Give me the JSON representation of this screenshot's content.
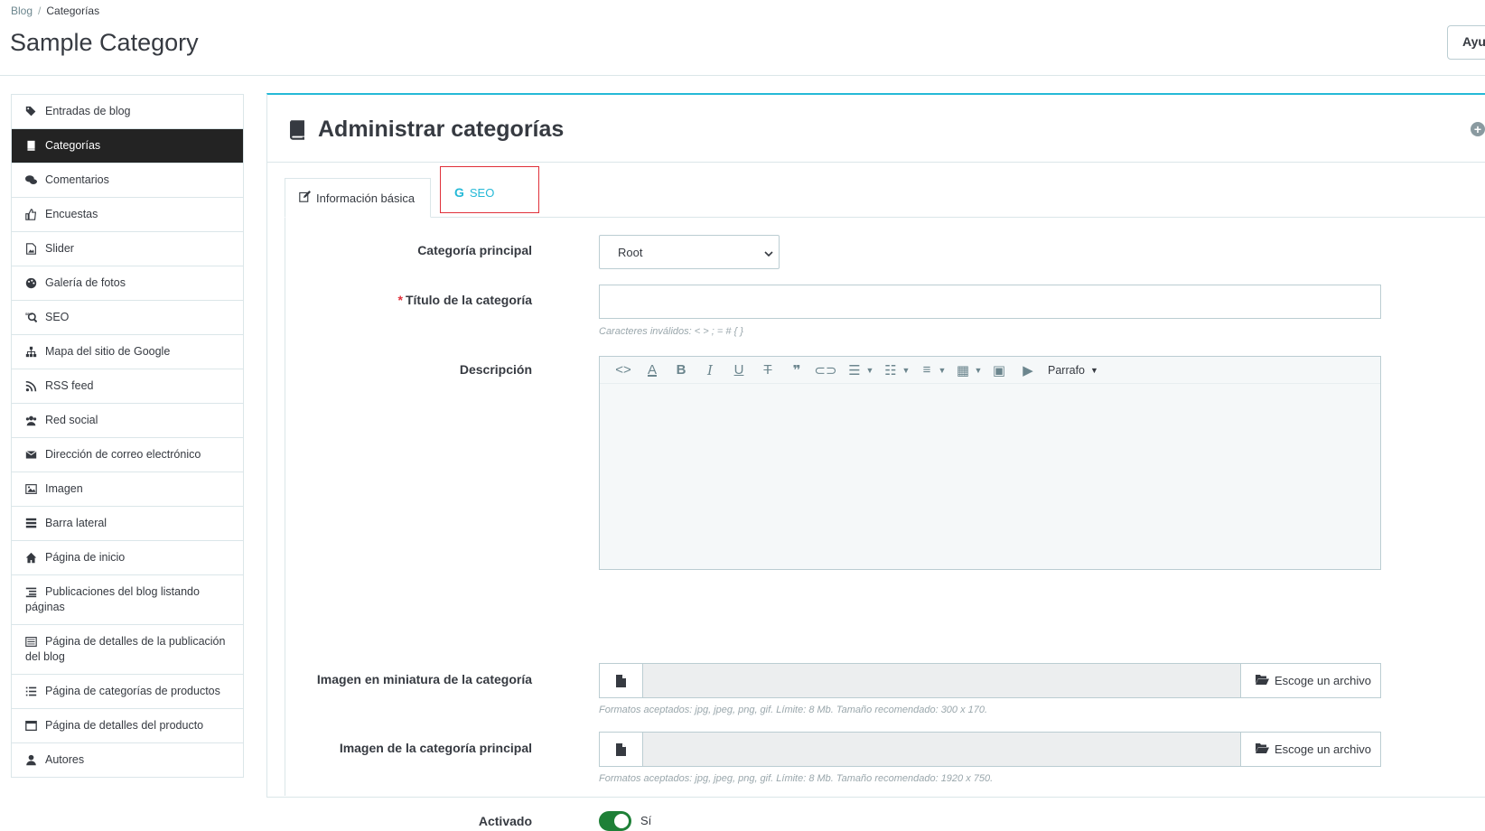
{
  "breadcrumb": {
    "parent": "Blog",
    "separator": "/",
    "current": "Categorías"
  },
  "page": {
    "title": "Sample Category",
    "help_button": "Ayu"
  },
  "sidebar": {
    "items": [
      {
        "label": "Entradas de blog",
        "icon": "tags-icon"
      },
      {
        "label": "Categorías",
        "icon": "book-icon",
        "active": true
      },
      {
        "label": "Comentarios",
        "icon": "comments-icon"
      },
      {
        "label": "Encuestas",
        "icon": "thumbs-up-icon"
      },
      {
        "label": "Slider",
        "icon": "file-image-icon"
      },
      {
        "label": "Galería de fotos",
        "icon": "palette-icon"
      },
      {
        "label": "SEO",
        "icon": "seo-search-icon"
      },
      {
        "label": "Mapa del sitio de Google",
        "icon": "sitemap-icon"
      },
      {
        "label": "RSS feed",
        "icon": "rss-icon"
      },
      {
        "label": "Red social",
        "icon": "users-icon"
      },
      {
        "label": "Dirección de correo electrónico",
        "icon": "envelope-icon"
      },
      {
        "label": "Imagen",
        "icon": "image-icon"
      },
      {
        "label": "Barra lateral",
        "icon": "sidebar-icon"
      },
      {
        "label": "Página de inicio",
        "icon": "home-icon"
      },
      {
        "label": "Publicaciones del blog listando páginas",
        "icon": "list-indent-icon"
      },
      {
        "label": "Página de detalles de la publicación del blog",
        "icon": "list-alt-icon"
      },
      {
        "label": "Página de categorías de productos",
        "icon": "list-icon"
      },
      {
        "label": "Página de detalles del producto",
        "icon": "window-icon"
      },
      {
        "label": "Autores",
        "icon": "user-icon"
      }
    ]
  },
  "panel": {
    "title": "Administrar categorías",
    "tabs": [
      {
        "label": "Información básica",
        "icon": "edit-icon"
      },
      {
        "label": "SEO",
        "icon": "google-icon",
        "icon_text": "G"
      }
    ]
  },
  "form": {
    "parent_category": {
      "label": "Categoría principal",
      "value": "Root"
    },
    "title": {
      "label": "Título de la categoría",
      "required_mark": "*",
      "value": "",
      "help": "Caracteres inválidos: < > ; = # { }"
    },
    "description": {
      "label": "Descripción",
      "paragraph_label": "Parrafo"
    },
    "thumbnail": {
      "label": "Imagen en miniatura de la categoría",
      "button": "Escoge un archivo",
      "help": "Formatos aceptados: jpg, jpeg, png, gif. Límite: 8 Mb. Tamaño recomendado: 300 x 170."
    },
    "main_image": {
      "label": "Imagen de la categoría principal",
      "button": "Escoge un archivo",
      "help": "Formatos aceptados: jpg, jpeg, png, gif. Límite: 8 Mb. Tamaño recomendado: 1920 x 750."
    },
    "enabled": {
      "label": "Activado",
      "value_label": "Sí",
      "on": true
    }
  },
  "colors": {
    "accent": "#25b9d7",
    "active_bg": "#232323",
    "toggle_on": "#1e8037",
    "highlight_border": "#e0303a"
  }
}
